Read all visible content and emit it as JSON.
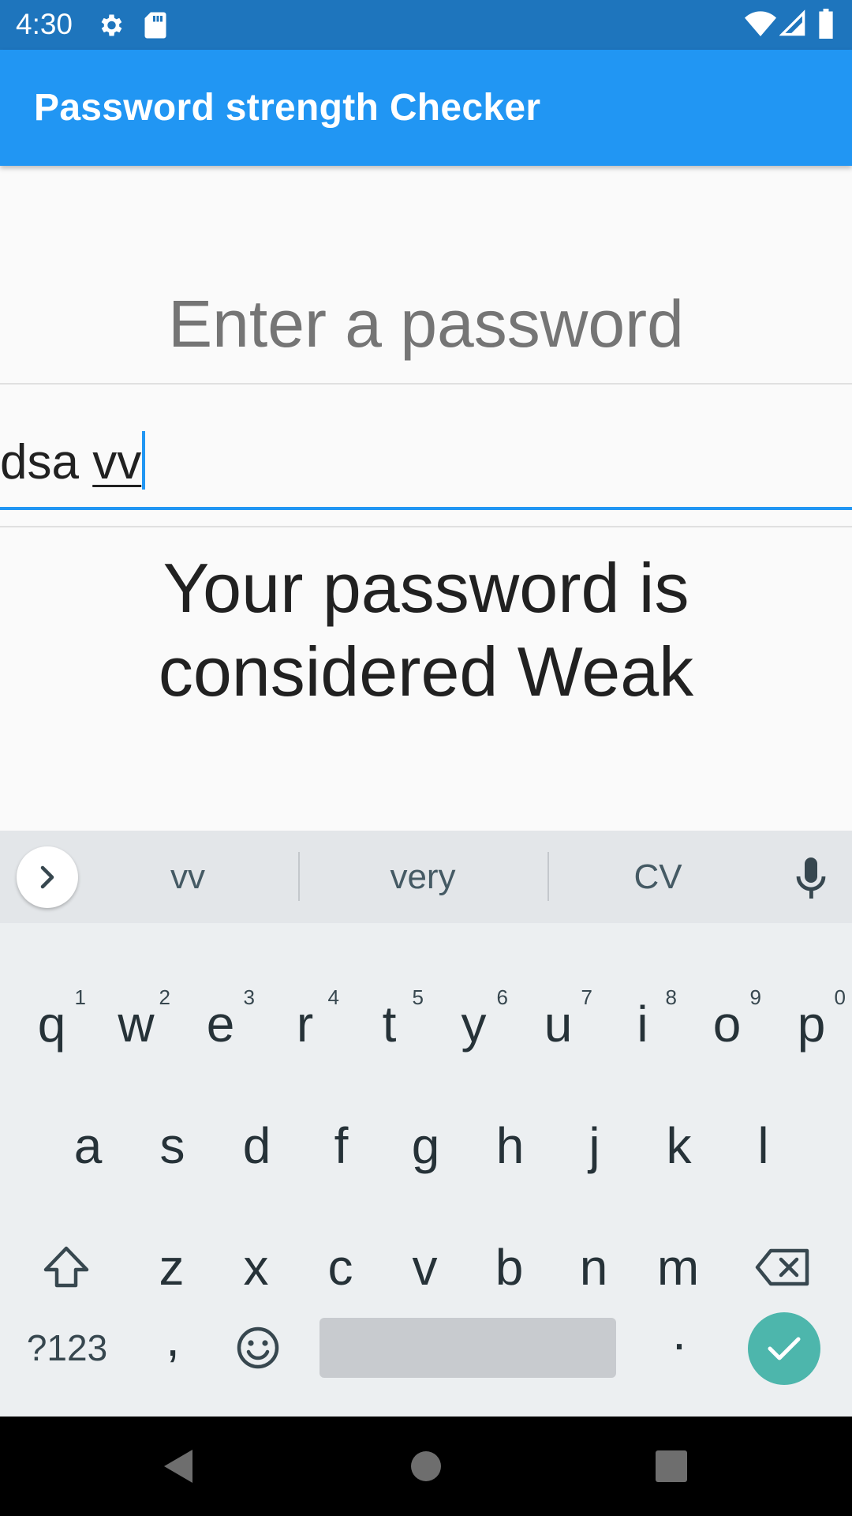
{
  "status_bar": {
    "time": "4:30",
    "icons": [
      "gear-icon",
      "sd-card-icon",
      "wifi-icon",
      "signal-icon",
      "battery-icon"
    ]
  },
  "app_bar": {
    "title": "Password strength Checker",
    "color": "#2196f3"
  },
  "main": {
    "prompt": "Enter a password",
    "input_value_committed": "dsa ",
    "input_value_composing": "vv",
    "result_line1": "Your password is",
    "result_line2": "considered Weak"
  },
  "keyboard": {
    "suggestions": [
      "vv",
      "very",
      "CV"
    ],
    "row1": [
      {
        "label": "q",
        "hint": "1"
      },
      {
        "label": "w",
        "hint": "2"
      },
      {
        "label": "e",
        "hint": "3"
      },
      {
        "label": "r",
        "hint": "4"
      },
      {
        "label": "t",
        "hint": "5"
      },
      {
        "label": "y",
        "hint": "6"
      },
      {
        "label": "u",
        "hint": "7"
      },
      {
        "label": "i",
        "hint": "8"
      },
      {
        "label": "o",
        "hint": "9"
      },
      {
        "label": "p",
        "hint": "0"
      }
    ],
    "row2": [
      "a",
      "s",
      "d",
      "f",
      "g",
      "h",
      "j",
      "k",
      "l"
    ],
    "row3": [
      "z",
      "x",
      "c",
      "v",
      "b",
      "n",
      "m"
    ],
    "symbols_label": "?123",
    "comma_label": ",",
    "period_label": ".",
    "accent_color": "#4db6ac"
  },
  "nav_bar": {
    "icons": [
      "back-icon",
      "home-icon",
      "recents-icon"
    ]
  }
}
